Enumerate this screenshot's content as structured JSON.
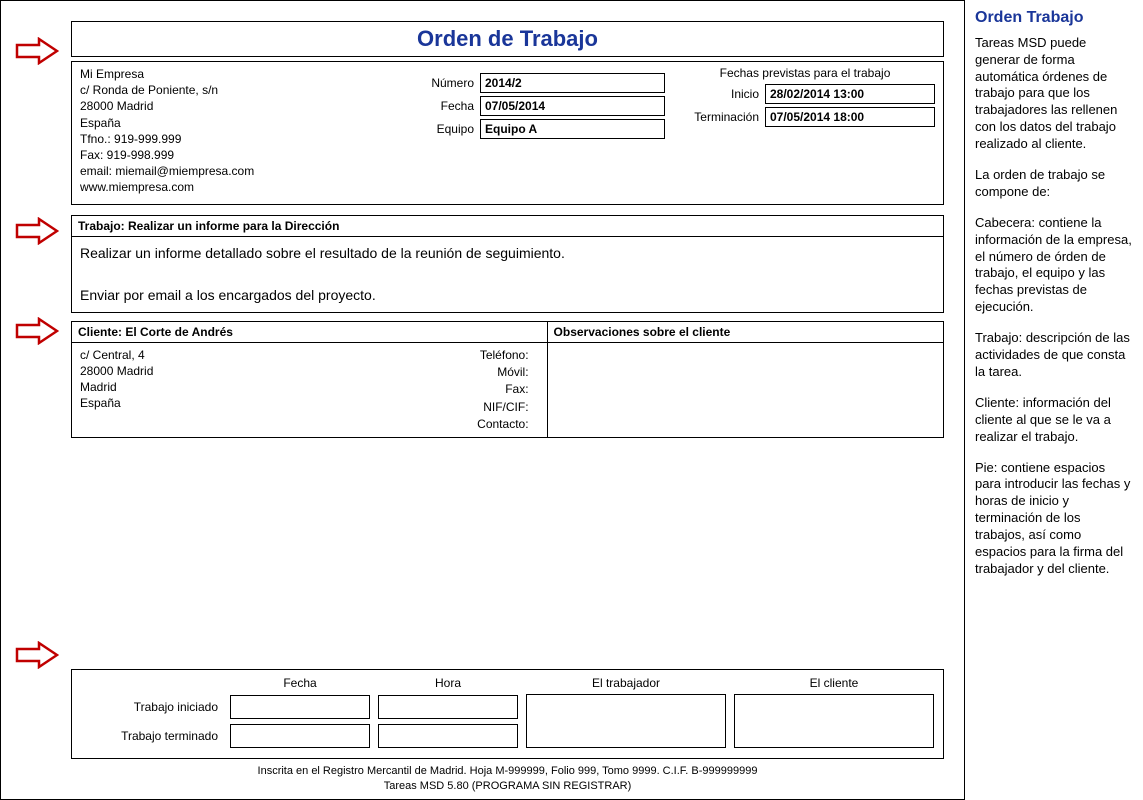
{
  "doc": {
    "title": "Orden de Trabajo",
    "company": {
      "name": "Mi Empresa",
      "addr1": "c/ Ronda de Poniente, s/n",
      "addr2": "28000 Madrid",
      "country": "España",
      "phone": "Tfno.: 919-999.999",
      "fax": "Fax: 919-998.999",
      "email": "email: miemail@miempresa.com",
      "web": "www.miempresa.com"
    },
    "meta": {
      "numero_label": "Número",
      "numero": "2014/2",
      "fecha_label": "Fecha",
      "fecha": "07/05/2014",
      "equipo_label": "Equipo",
      "equipo": "Equipo A",
      "fechas_title": "Fechas previstas para el trabajo",
      "inicio_label": "Inicio",
      "inicio": "28/02/2014 13:00",
      "fin_label": "Terminación",
      "fin": "07/05/2014 18:00"
    },
    "trabajo": {
      "head": "Trabajo: Realizar un informe para la Dirección",
      "line1": "Realizar un informe detallado sobre el resultado de la reunión de seguimiento.",
      "line2": "Enviar por email a los encargados del proyecto."
    },
    "cliente": {
      "head": "Cliente: El Corte de Andrés",
      "addr1": "c/ Central, 4",
      "addr2": "28000 Madrid",
      "city": "Madrid",
      "country": "España",
      "f_tel": "Teléfono:",
      "f_mov": "Móvil:",
      "f_fax": "Fax:",
      "f_nif": "NIF/CIF:",
      "f_con": "Contacto:",
      "obs_head": "Observaciones sobre el cliente"
    },
    "footer": {
      "h_fecha": "Fecha",
      "h_hora": "Hora",
      "h_trabajador": "El trabajador",
      "h_cliente": "El cliente",
      "r_iniciado": "Trabajo iniciado",
      "r_terminado": "Trabajo terminado"
    },
    "legal1": "Inscrita en el Registro Mercantil de Madrid. Hoja M-999999, Folio 999, Tomo 9999. C.I.F. B-999999999",
    "legal2": "Tareas MSD 5.80 (PROGRAMA SIN REGISTRAR)"
  },
  "help": {
    "title": "Orden Trabajo",
    "p1": "Tareas MSD puede generar de forma automática órdenes de trabajo para que los trabajadores las rellenen con los datos del trabajo realizado al cliente.",
    "p2": "La orden de trabajo se compone de:",
    "p3": "Cabecera: contiene la información de la empresa, el número de órden de trabajo, el equipo y las fechas previstas de ejecución.",
    "p4": "Trabajo: descripción de las actividades de que consta la tarea.",
    "p5": "Cliente: información del cliente al que se le va a realizar el trabajo.",
    "p6": "Pie: contiene espacios para introducir las fechas y horas de inicio y terminación de los trabajos, así como espacios para la firma del trabajador y del cliente."
  },
  "arrow_positions": [
    36,
    216,
    316,
    640
  ]
}
